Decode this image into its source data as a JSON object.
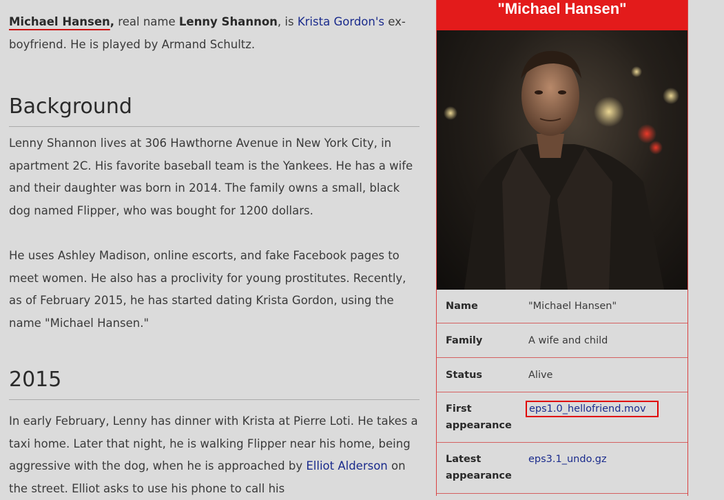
{
  "article": {
    "intro": {
      "name": "Michael Hansen",
      "comma": ",",
      "t1": " real name ",
      "real_name": "Lenny Shannon",
      "t2": ", is ",
      "link": "Krista Gordon's",
      "t3": " ex-boyfriend. He is played by Armand Schultz."
    },
    "background": {
      "heading": "Background",
      "p1": "Lenny Shannon lives at 306 Hawthorne Avenue in New York City, in apartment 2C. His favorite baseball team is the Yankees. He has a wife and their daughter was born in 2014. The family owns a small, black dog named Flipper, who was bought for 1200 dollars.",
      "p2": "He uses Ashley Madison, online escorts, and fake Facebook pages to meet women. He also has a proclivity for young prostitutes. Recently, as of February 2015, he has started dating Krista Gordon, using the name \"Michael Hansen.\""
    },
    "section_2015": {
      "heading": "2015",
      "t1": "In early February, Lenny has dinner with Krista at Pierre Loti. He takes a taxi home. Later that night, he is walking Flipper near his home, being aggressive with the dog, when he is approached by ",
      "link": "Elliot Alderson",
      "t2": " on the street. Elliot asks to use his phone to call his"
    }
  },
  "infobox": {
    "title": "\"Michael Hansen\"",
    "rows": [
      {
        "label": "Name",
        "value": "\"Michael Hansen\""
      },
      {
        "label": "Family",
        "value": "A wife and child"
      },
      {
        "label": "Status",
        "value": "Alive"
      },
      {
        "label": "First appearance",
        "value": "eps1.0_hellofriend.mov"
      },
      {
        "label": "Latest appearance",
        "value": "eps3.1_undo.gz"
      }
    ]
  },
  "colors": {
    "accent": "#e31b1b",
    "link": "#1a2b8c",
    "background": "#dbdbdb"
  }
}
